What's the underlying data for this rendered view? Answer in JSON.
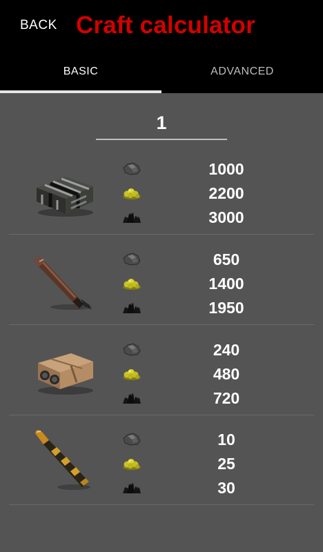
{
  "header": {
    "back_label": "BACK",
    "title": "Craft calculator"
  },
  "tabs": [
    {
      "label": "BASIC",
      "active": true
    },
    {
      "label": "ADVANCED",
      "active": false
    }
  ],
  "quantity": "1",
  "resources": [
    "sulfur-ore-icon",
    "gunpowder-icon",
    "charcoal-icon"
  ],
  "items": [
    {
      "icon": "c4-explosive-icon",
      "values": [
        "1000",
        "2200",
        "3000"
      ]
    },
    {
      "icon": "rocket-icon",
      "values": [
        "650",
        "1400",
        "1950"
      ]
    },
    {
      "icon": "satchel-charge-icon",
      "values": [
        "240",
        "480",
        "720"
      ]
    },
    {
      "icon": "explosive-ammo-icon",
      "values": [
        "10",
        "25",
        "30"
      ]
    }
  ],
  "colors": {
    "title": "#d40000",
    "background": "#545454",
    "bar": "#000000"
  }
}
